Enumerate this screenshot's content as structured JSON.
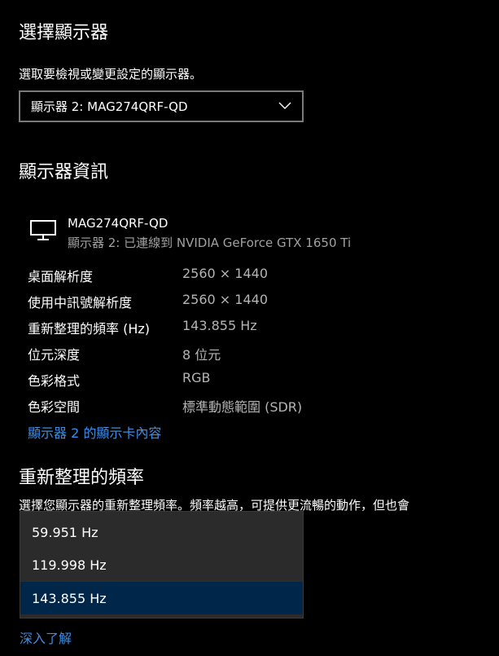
{
  "select_display": {
    "title": "選擇顯示器",
    "subtitle": "選取要檢視或變更設定的顯示器。",
    "dropdown_value": "顯示器 2: MAG274QRF-QD"
  },
  "display_info": {
    "title": "顯示器資訊",
    "monitor_name": "MAG274QRF-QD",
    "connection": "顯示器 2: 已連線到 NVIDIA GeForce GTX 1650 Ti",
    "rows": [
      {
        "label": "桌面解析度",
        "value": "2560 × 1440"
      },
      {
        "label": "使用中訊號解析度",
        "value": "2560 × 1440"
      },
      {
        "label": "重新整理的頻率 (Hz)",
        "value": "143.855 Hz"
      },
      {
        "label": "位元深度",
        "value": "8 位元"
      },
      {
        "label": "色彩格式",
        "value": "RGB"
      },
      {
        "label": "色彩空間",
        "value": "標準動態範圍 (SDR)"
      }
    ],
    "adapter_link": "顯示器 2 的顯示卡內容"
  },
  "refresh_rate": {
    "title": "重新整理的頻率",
    "description": "選擇您顯示器的重新整理頻率。頻率越高，可提供更流暢的動作，但也會",
    "options": [
      "59.951 Hz",
      "119.998 Hz",
      "143.855 Hz"
    ],
    "selected": "143.855 Hz",
    "learn_more": "深入了解"
  },
  "colors": {
    "background": "#000000",
    "link": "#3a8ee6",
    "selected_option": "#00264a",
    "popup_bg": "#2b2b2b"
  }
}
